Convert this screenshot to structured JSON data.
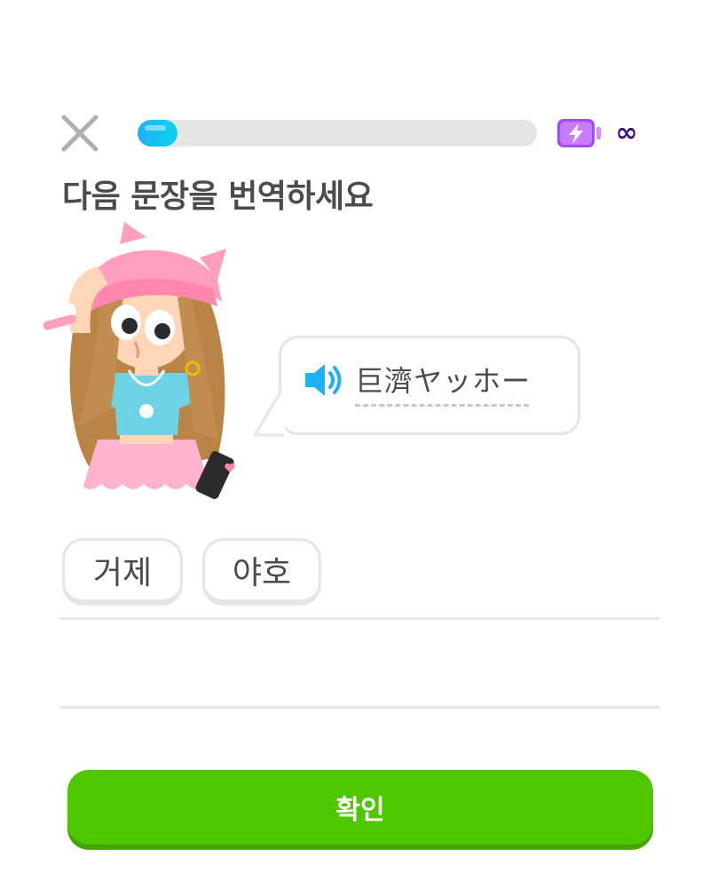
{
  "header": {
    "close_icon": "close-icon",
    "progress": 0.1,
    "energy_icon": "energy-battery-icon",
    "energy_value": "∞"
  },
  "colors": {
    "progress_fill": "#1cb0f6",
    "primary_button": "#4fc700",
    "energy_purple": "#a04cf0",
    "infinity": "#3c0e8a"
  },
  "instruction": "다음 문장을 번역하세요",
  "prompt": {
    "speaker_icon": "speaker-icon",
    "phrase": "巨濟ヤッホー"
  },
  "word_bank": [
    {
      "label": "거제"
    },
    {
      "label": "야호"
    }
  ],
  "footer": {
    "check_label": "확인"
  }
}
